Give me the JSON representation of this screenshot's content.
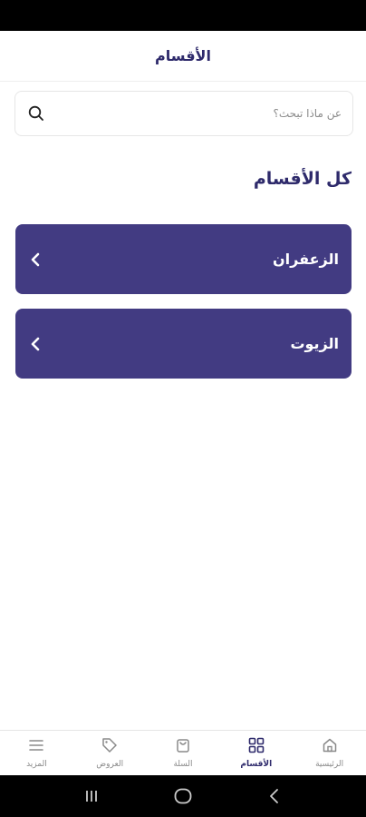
{
  "header": {
    "title": "الأقسام"
  },
  "search": {
    "placeholder": "عن ماذا تبحث؟",
    "value": ""
  },
  "section": {
    "title": "كل الأقسام"
  },
  "categories": [
    {
      "label": "الزعفران"
    },
    {
      "label": "الزيوت"
    }
  ],
  "bottom_nav": {
    "items": [
      {
        "label": "المزيد",
        "icon": "menu-icon"
      },
      {
        "label": "العروض",
        "icon": "tag-icon"
      },
      {
        "label": "السلة",
        "icon": "bag-icon"
      },
      {
        "label": "الأقسام",
        "icon": "grid-icon",
        "active": true
      },
      {
        "label": "الرئيسية",
        "icon": "home-icon"
      }
    ]
  },
  "colors": {
    "primary": "#423b82",
    "title": "#2e2a6b",
    "muted": "#8a8a8a"
  }
}
